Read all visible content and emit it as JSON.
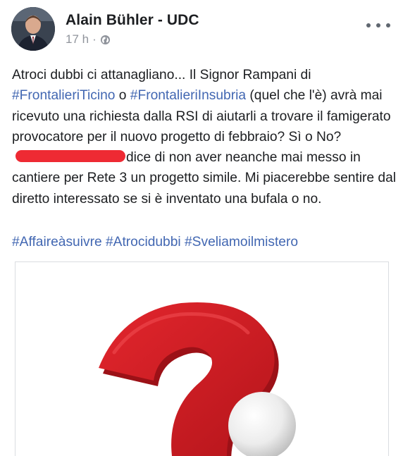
{
  "post": {
    "author": "Alain Bühler - UDC",
    "time": "17 h",
    "separator": "·",
    "privacy_icon": "globe-icon",
    "more_icon": "more-options-icon",
    "text": {
      "p1": "Atroci dubbi ci attanagliano... Il Signor Rampani di ",
      "hashtag1": "#FrontalieriTicino",
      "p2": " o ",
      "hashtag2": "#FrontalieriInsubria",
      "p3": " (quel che l'è) avrà mai ricevuto una richiesta dalla RSI di aiutarli a trovare il famigerato provocatore per il nuovo progetto di febbraio? Sì o No?",
      "p4": "dice di non aver neanche mai messo in cantiere per Rete 3 un progetto simile. Mi piacerebbe sentire dal diretto interessato se si è inventato una bufala o no."
    },
    "tags": [
      "#Affaireàsuivre",
      "#Atrocidubbi",
      "#Sveliamoilmistero"
    ],
    "image": {
      "subject": "question-mark-image",
      "mark_color": "#d91f26",
      "ball_color": "#f2f2f2"
    },
    "redaction_color": "#ee2a33",
    "link_color": "#4267b2"
  }
}
